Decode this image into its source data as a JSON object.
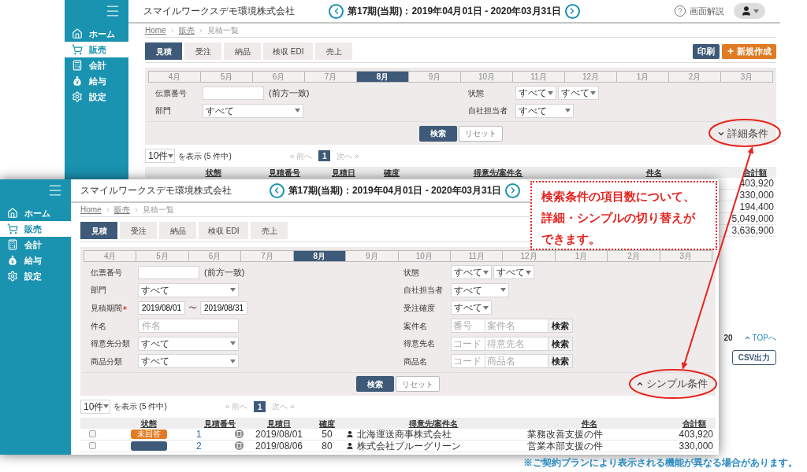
{
  "back_screen": {
    "sidebar": {
      "items": [
        {
          "label": "ホーム",
          "selected": false
        },
        {
          "label": "販売",
          "selected": true
        },
        {
          "label": "会計",
          "selected": false
        },
        {
          "label": "給与",
          "selected": false
        },
        {
          "label": "設定",
          "selected": false
        }
      ]
    },
    "header": {
      "company": "スマイルワークスデモ環境株式会社",
      "period": "第17期(当期)：2019年04月01日 - 2020年03月31日",
      "help": "画面解説"
    },
    "breadcrumb": [
      "Home",
      "販売",
      "見積一覧"
    ],
    "tabs": [
      {
        "label": "見積",
        "selected": true
      },
      {
        "label": "受注",
        "selected": false
      },
      {
        "label": "納品",
        "selected": false
      },
      {
        "label": "検収 EDI",
        "selected": false
      },
      {
        "label": "売上",
        "selected": false
      }
    ],
    "print_button": "印刷",
    "new_button": "新規作成",
    "months": [
      {
        "label": "4月",
        "selected": false
      },
      {
        "label": "5月",
        "selected": false
      },
      {
        "label": "6月",
        "selected": false
      },
      {
        "label": "7月",
        "selected": false
      },
      {
        "label": "8月",
        "selected": true
      },
      {
        "label": "9月",
        "selected": false
      },
      {
        "label": "10月",
        "selected": false
      },
      {
        "label": "11月",
        "selected": false
      },
      {
        "label": "12月",
        "selected": false
      },
      {
        "label": "1月",
        "selected": false
      },
      {
        "label": "2月",
        "selected": false
      },
      {
        "label": "3月",
        "selected": false
      }
    ],
    "filters_left": [
      {
        "label": "伝票番号",
        "kind": "text",
        "note": "(前方一致)",
        "required": false
      },
      {
        "label": "部門",
        "kind": "select",
        "value": "すべて",
        "required": false
      }
    ],
    "filters_right": [
      {
        "label": "状態",
        "kind": "select_pair",
        "values": [
          "すべて",
          "すべて"
        ],
        "required": false
      },
      {
        "label": "自社担当者",
        "kind": "select_mid",
        "value": "すべて",
        "required": false
      }
    ],
    "search_button": "検索",
    "reset_button": "リセット",
    "toggle": {
      "label": "詳細条件",
      "expanded": false
    },
    "pager": {
      "page_size": "10件",
      "suffix": "を表示 (5 件中)",
      "prev": "« 前へ",
      "pages": [
        {
          "label": "1",
          "selected": true
        }
      ],
      "next": "次へ »"
    },
    "table": {
      "columns": [
        "状態",
        "見積番号",
        "見積日",
        "確度",
        "得意先/案件名",
        "件名",
        "合計額"
      ],
      "rows": [
        {
          "amount": "403,920"
        },
        {
          "amount": "330,000"
        },
        {
          "amount": "194,400"
        },
        {
          "amount": "5,049,000"
        },
        {
          "amount": "3,636,900"
        }
      ]
    },
    "footer": {
      "page_info": "20",
      "top_link": "TOPへ",
      "csv_button": "CSV出力"
    }
  },
  "front_screen": {
    "sidebar": {
      "items": [
        {
          "label": "ホーム",
          "selected": false
        },
        {
          "label": "販売",
          "selected": true
        },
        {
          "label": "会計",
          "selected": false
        },
        {
          "label": "給与",
          "selected": false
        },
        {
          "label": "設定",
          "selected": false
        }
      ]
    },
    "header": {
      "company": "スマイルワークスデモ環境株式会社",
      "period": "第17期(当期)：2019年04月01日 - 2020年03月31日"
    },
    "breadcrumb": [
      "Home",
      "販売",
      "見積一覧"
    ],
    "tabs": [
      {
        "label": "見積",
        "selected": true
      },
      {
        "label": "受注",
        "selected": false
      },
      {
        "label": "納品",
        "selected": false
      },
      {
        "label": "検収 EDI",
        "selected": false
      },
      {
        "label": "売上",
        "selected": false
      }
    ],
    "months": [
      {
        "label": "4月",
        "selected": false
      },
      {
        "label": "5月",
        "selected": false
      },
      {
        "label": "6月",
        "selected": false
      },
      {
        "label": "7月",
        "selected": false
      },
      {
        "label": "8月",
        "selected": true
      },
      {
        "label": "9月",
        "selected": false
      },
      {
        "label": "10月",
        "selected": false
      },
      {
        "label": "11月",
        "selected": false
      },
      {
        "label": "12月",
        "selected": false
      },
      {
        "label": "1月",
        "selected": false
      },
      {
        "label": "2月",
        "selected": false
      },
      {
        "label": "3月",
        "selected": false
      }
    ],
    "filters_left": [
      {
        "label": "伝票番号",
        "kind": "text",
        "note": "(前方一致)",
        "required": false
      },
      {
        "label": "部門",
        "kind": "select",
        "value": "すべて",
        "required": false
      },
      {
        "label": "見積期間",
        "kind": "date_range",
        "from": "2019/08/01",
        "separator": "〜",
        "to": "2019/08/31",
        "required": true
      },
      {
        "label": "件名",
        "kind": "text_wide",
        "placeholder": "件名",
        "required": false
      },
      {
        "label": "得意先分類",
        "kind": "select",
        "value": "すべて",
        "required": false
      },
      {
        "label": "商品分類",
        "kind": "select",
        "value": "すべて",
        "required": false
      }
    ],
    "filters_right": [
      {
        "label": "状態",
        "kind": "select_pair",
        "values": [
          "すべて",
          "すべて"
        ],
        "required": false
      },
      {
        "label": "自社担当者",
        "kind": "select_mid",
        "value": "すべて",
        "required": false
      },
      {
        "label": "受注確度",
        "kind": "select_small",
        "value": "すべて",
        "required": false
      },
      {
        "label": "案件名",
        "kind": "code_search",
        "code_placeholder": "番号",
        "name_placeholder": "案件名",
        "button": "検索",
        "required": false
      },
      {
        "label": "得意先名",
        "kind": "code_search",
        "code_placeholder": "コード",
        "name_placeholder": "得意先名",
        "button": "検索",
        "required": false
      },
      {
        "label": "商品名",
        "kind": "code_search",
        "code_placeholder": "コード",
        "name_placeholder": "商品名",
        "button": "検索",
        "required": false
      }
    ],
    "search_button": "検索",
    "reset_button": "リセット",
    "toggle": {
      "label": "シンプル条件",
      "expanded": true
    },
    "pager": {
      "page_size": "10件",
      "suffix": "を表示 (5 件中)",
      "prev": "« 前へ",
      "pages": [
        {
          "label": "1",
          "selected": true
        }
      ],
      "next": "次へ »"
    },
    "table": {
      "columns": [
        "状態",
        "見積番号",
        "見積日",
        "確度",
        "得意先/案件名",
        "件名",
        "合計額"
      ],
      "rows": [
        {
          "checked": false,
          "status": {
            "label": "未回答",
            "color": "#e07b24"
          },
          "number": "1",
          "date": "2019/08/01",
          "probability": "50",
          "client": "北海運送商事株式会社",
          "subject": "業務改善支援の件",
          "amount": "403,920"
        },
        {
          "checked": false,
          "status": {
            "color": "#3e5a78"
          },
          "number": "2",
          "date": "2019/08/06",
          "probability": "80",
          "client": "株式会社ブルーグリーン",
          "subject": "営業本部支援の件",
          "amount": "330,000"
        }
      ]
    }
  },
  "callout": {
    "text": "検索条件の項目数について、詳細・シンプルの切り替えができます。"
  },
  "footnote": "※ご契約プランにより表示される機能が異なる場合があります。"
}
